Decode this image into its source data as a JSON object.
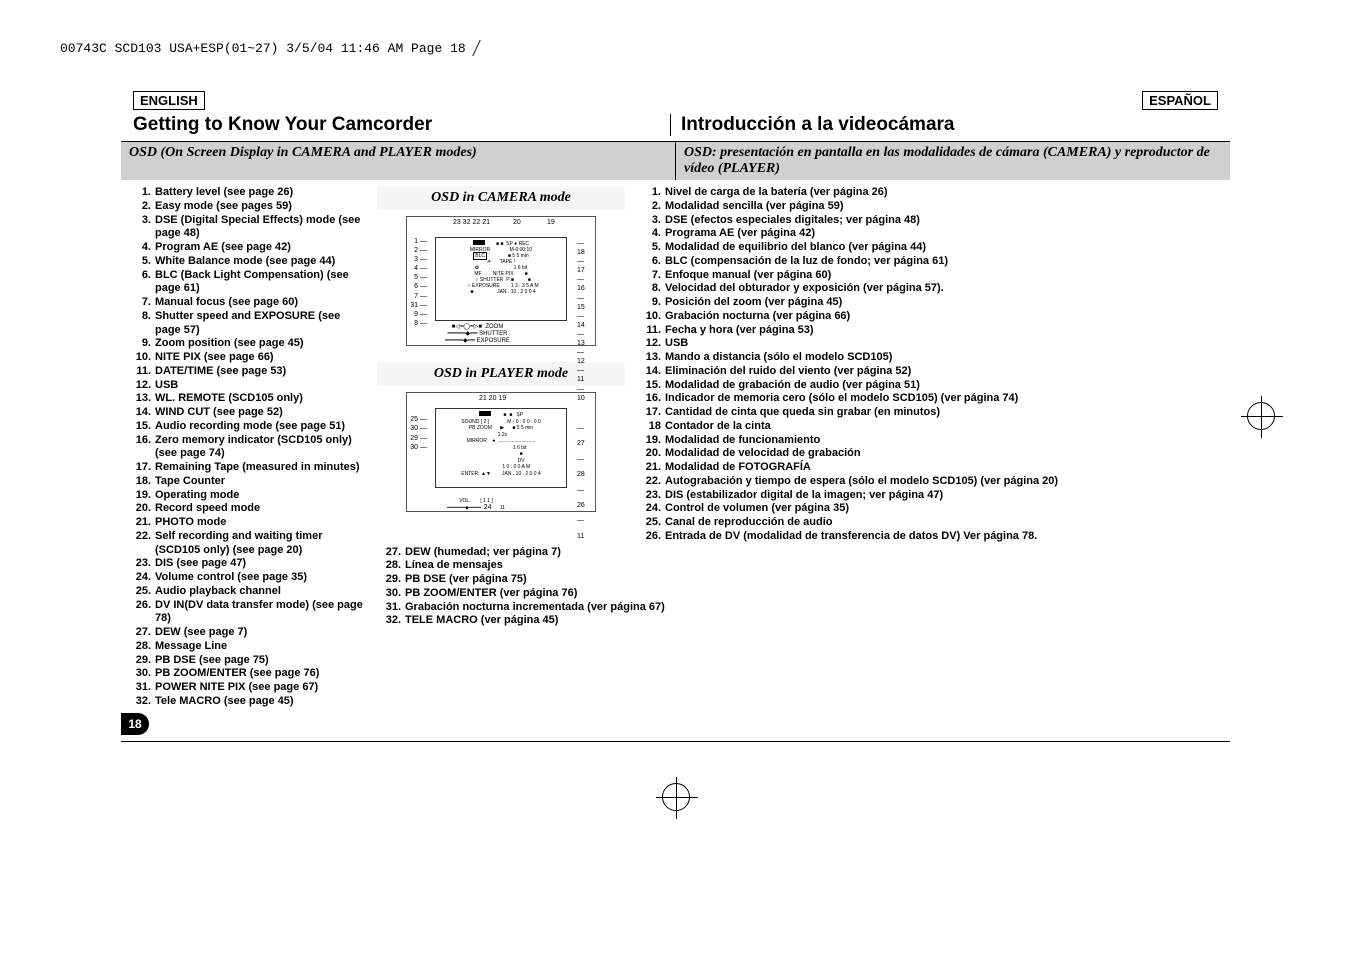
{
  "header": {
    "jobline": "00743C SCD103 USA+ESP(01~27)  3/5/04 11:46 AM  Page 18"
  },
  "lang": {
    "left": "ENGLISH",
    "right": "ESPAÑOL"
  },
  "titles": {
    "left": "Getting to Know Your Camcorder",
    "right": "Introducción a la videocámara"
  },
  "subheads": {
    "left": "OSD (On Screen Display in CAMERA and PLAYER modes)",
    "right": "OSD: presentación en pantalla en las modalidades de cámara (CAMERA) y reproductor de vídeo (PLAYER)"
  },
  "osd_caption_camera": "OSD in CAMERA mode",
  "osd_caption_player": "OSD in PLAYER mode",
  "page_number": "18",
  "left_items": [
    {
      "n": "1.",
      "t": "Battery level (see page 26)"
    },
    {
      "n": "2.",
      "t": "Easy mode (see pages 59)"
    },
    {
      "n": "3.",
      "t": "DSE (Digital Special Effects) mode (see page 48)"
    },
    {
      "n": "4.",
      "t": "Program AE (see page 42)"
    },
    {
      "n": "5.",
      "t": "White Balance mode (see page 44)"
    },
    {
      "n": "6.",
      "t": "BLC (Back Light Compensation) (see page 61)"
    },
    {
      "n": "7.",
      "t": "Manual focus (see page 60)"
    },
    {
      "n": "8.",
      "t": "Shutter speed and EXPOSURE (see page 57)"
    },
    {
      "n": "9.",
      "t": "Zoom position (see page 45)"
    },
    {
      "n": "10.",
      "t": "NITE PIX (see page 66)"
    },
    {
      "n": "11.",
      "t": "DATE/TIME (see page 53)"
    },
    {
      "n": "12.",
      "t": "USB"
    },
    {
      "n": "13.",
      "t": "WL. REMOTE (SCD105 only)"
    },
    {
      "n": "14.",
      "t": "WIND CUT (see page 52)"
    },
    {
      "n": "15.",
      "t": "Audio recording mode (see page 51)"
    },
    {
      "n": "16.",
      "t": "Zero memory indicator (SCD105 only) (see page 74)"
    },
    {
      "n": "17.",
      "t": "Remaining Tape (measured in minutes)"
    },
    {
      "n": "18.",
      "t": "Tape Counter"
    },
    {
      "n": "19.",
      "t": "Operating mode"
    },
    {
      "n": "20.",
      "t": "Record speed mode"
    },
    {
      "n": "21.",
      "t": "PHOTO mode"
    },
    {
      "n": "22.",
      "t": "Self recording and waiting timer (SCD105 only) (see page 20)"
    },
    {
      "n": "23.",
      "t": "DIS (see page 47)"
    },
    {
      "n": "24.",
      "t": "Volume control (see page 35)"
    },
    {
      "n": "25.",
      "t": "Audio playback channel"
    },
    {
      "n": "26.",
      "t": "DV IN(DV data transfer mode) (see page 78)"
    },
    {
      "n": "27.",
      "t": "DEW (see page 7)"
    },
    {
      "n": "28.",
      "t": "Message Line"
    },
    {
      "n": "29.",
      "t": "PB DSE (see page 75)"
    },
    {
      "n": "30.",
      "t": "PB ZOOM/ENTER (see page 76)"
    },
    {
      "n": "31.",
      "t": "POWER NITE PIX (see page 67)"
    },
    {
      "n": "32.",
      "t": "Tele MACRO (see page 45)"
    }
  ],
  "right_items": [
    {
      "n": "1.",
      "t": "Nivel de carga de la batería (ver página 26)"
    },
    {
      "n": "2.",
      "t": "Modalidad sencilla (ver página 59)"
    },
    {
      "n": "3.",
      "t": "DSE (efectos especiales digitales; ver página 48)"
    },
    {
      "n": "4.",
      "t": "Programa AE (ver página 42)"
    },
    {
      "n": "5.",
      "t": "Modalidad de equilibrio del blanco (ver página 44)"
    },
    {
      "n": "6.",
      "t": "BLC (compensación de la luz de fondo; ver página 61)"
    },
    {
      "n": "7.",
      "t": "Enfoque manual (ver página 60)"
    },
    {
      "n": "8.",
      "t": "Velocidad del obturador y exposición (ver página 57)."
    },
    {
      "n": "9.",
      "t": "Posición del zoom (ver página 45)"
    },
    {
      "n": "10.",
      "t": "Grabación nocturna (ver página 66)"
    },
    {
      "n": "11.",
      "t": "Fecha y hora (ver página 53)"
    },
    {
      "n": "12.",
      "t": "USB"
    },
    {
      "n": "13.",
      "t": "Mando a distancia (sólo el modelo SCD105)"
    },
    {
      "n": "14.",
      "t": "Eliminación del ruido del viento (ver página 52)"
    },
    {
      "n": "15.",
      "t": "Modalidad de grabación de audio (ver página 51)"
    },
    {
      "n": "16.",
      "t": "Indicador de memoria cero (sólo el modelo SCD105) (ver página 74)"
    },
    {
      "n": "17.",
      "t": "Cantidad de cinta que queda sin grabar (en minutos)"
    },
    {
      "n": "18",
      "t": "Contador de la cinta"
    },
    {
      "n": "19.",
      "t": "Modalidad de funcionamiento"
    },
    {
      "n": "20.",
      "t": "Modalidad de velocidad de grabación"
    },
    {
      "n": "21.",
      "t": "Modalidad de FOTOGRAFÍA"
    },
    {
      "n": "22.",
      "t": "Autograbación y tiempo de espera (sólo el modelo SCD105) (ver página 20)"
    },
    {
      "n": "23.",
      "t": "DIS (estabilizador digital de la imagen; ver página 47)"
    },
    {
      "n": "24.",
      "t": "Control de volumen (ver página 35)"
    },
    {
      "n": "25.",
      "t": "Canal de reproducción de audio"
    },
    {
      "n": "26.",
      "t": "Entrada de DV (modalidad de transferencia de datos DV) Ver página 78."
    }
  ],
  "right_bottom": [
    {
      "n": "27.",
      "t": "DEW (humedad; ver página 7)"
    },
    {
      "n": "28.",
      "t": "Línea de mensajes"
    },
    {
      "n": "29.",
      "t": "PB DSE (ver página 75)"
    },
    {
      "n": "30.",
      "t": "PB ZOOM/ENTER (ver página 76)"
    },
    {
      "n": "31.",
      "t": "Grabación nocturna incrementada (ver página 67)"
    },
    {
      "n": "32.",
      "t": "TELE MACRO (ver página 45)"
    }
  ],
  "camera_osd": {
    "top_nums_left": "23 32 22 21",
    "top_nums_mid": "20",
    "top_nums_right": "19",
    "left_nums": [
      "1",
      "2",
      "3",
      "4",
      "5",
      "6",
      "7",
      "31",
      "9",
      "8"
    ],
    "right_nums": [
      "18",
      "17",
      "16",
      "15",
      "14",
      "13",
      "12",
      "11",
      "10"
    ],
    "inner_labels": [
      "M-0:00:10",
      "REC",
      "5 5 min",
      "TAPE !",
      "1 6 bit",
      "MIRROR",
      "BLC",
      "NITE PIX",
      "SHUTTER",
      "EXPOSURE",
      "ZOOM",
      "SHUTTER",
      "EXPOSURE",
      "MF",
      "1 3 : 3 5 A M",
      "JAN . 10 , 2 0 0 4"
    ]
  },
  "player_osd": {
    "top_nums": "21    20      19",
    "left_nums": [
      "25",
      "30",
      "29",
      "30"
    ],
    "right_nums": [
      "27",
      "28",
      "26",
      "11"
    ],
    "inner_labels": [
      "SP",
      "M - 0 : 0 0 : 0 0",
      "5 5 min",
      "SOUND [ 2 ]",
      "PB ZOOM",
      "1.2x",
      "MIRROR",
      "1 6 bit",
      "DV",
      "1 0 : 0 0 A M",
      "JAN . 10 , 2 0 0 4",
      "ENTER:",
      "VOL.",
      "[ 1 1 ]",
      "24"
    ]
  }
}
